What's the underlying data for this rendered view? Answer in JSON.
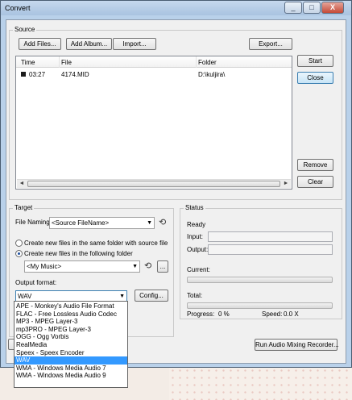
{
  "window": {
    "title": "Convert",
    "minimize": "_",
    "maximize": "□",
    "close": "X"
  },
  "source": {
    "label": "Source",
    "buttons": {
      "add_files": "Add Files...",
      "add_album": "Add Album...",
      "import": "Import...",
      "export": "Export..."
    },
    "columns": [
      "Time",
      "File",
      "Folder"
    ],
    "rows": [
      {
        "time": "03:27",
        "file": "4174.MID",
        "folder": "D:\\kuljira\\"
      }
    ],
    "side_buttons": {
      "start": "Start",
      "close": "Close",
      "remove": "Remove",
      "clear": "Clear"
    },
    "scroll_left": "◄",
    "scroll_right": "►"
  },
  "target": {
    "label": "Target",
    "file_naming_label": "File Naming:",
    "file_naming_value": "<Source FileName>",
    "radio_same_folder": "Create new files in the same folder with source file",
    "radio_following_folder": "Create new files in the following folder",
    "folder_value": "<My Music>",
    "browse": "...",
    "output_format_label": "Output format:",
    "output_format_value": "WAV",
    "config_button": "Config...",
    "format_options": [
      "APE - Monkey's Audio File Format",
      "FLAC - Free Lossless Audio Codec",
      "MP3 - MPEG Layer-3",
      "mp3PRO - MPEG Layer-3",
      "OGG - Ogg Vorbis",
      "RealMedia",
      "Speex - Speex Encoder",
      "WAV",
      "WMA - Windows Media Audio 7",
      "WMA - Windows Media Audio 9"
    ],
    "selected_index": 7
  },
  "status": {
    "label": "Status",
    "ready": "Ready",
    "input_label": "Input:",
    "output_label": "Output:",
    "current_label": "Current:",
    "total_label": "Total:",
    "progress_label": "Progress:",
    "progress_value": "0 %",
    "speed_label": "Speed:",
    "speed_value": "0.0 X"
  },
  "mixing_button": "Run Audio Mixing Recorder..."
}
